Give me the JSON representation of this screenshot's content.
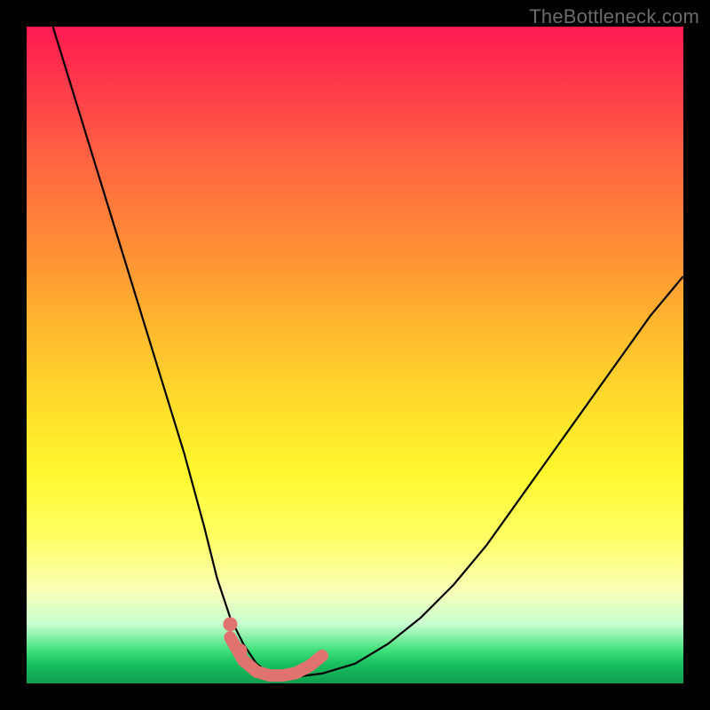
{
  "watermark": {
    "text": "TheBottleneck.com"
  },
  "chart_data": {
    "type": "line",
    "title": "",
    "xlabel": "",
    "ylabel": "",
    "xlim": [
      0,
      100
    ],
    "ylim": [
      0,
      100
    ],
    "grid": false,
    "gradient_stops": [
      {
        "pos": 0,
        "color": "#ff1a52"
      },
      {
        "pos": 10,
        "color": "#ff3e4a"
      },
      {
        "pos": 22,
        "color": "#ff6a3f"
      },
      {
        "pos": 34,
        "color": "#ff8f35"
      },
      {
        "pos": 46,
        "color": "#ffb92e"
      },
      {
        "pos": 58,
        "color": "#ffde2b"
      },
      {
        "pos": 68,
        "color": "#fff82f"
      },
      {
        "pos": 78,
        "color": "#ffff66"
      },
      {
        "pos": 86,
        "color": "#f8ffb8"
      },
      {
        "pos": 91,
        "color": "#c8ffd0"
      },
      {
        "pos": 95,
        "color": "#3fe07a"
      },
      {
        "pos": 97,
        "color": "#18c060"
      },
      {
        "pos": 100,
        "color": "#0f9e4e"
      }
    ],
    "series": [
      {
        "name": "bottleneck-curve",
        "stroke": "#000000",
        "stroke_width": 2.2,
        "x": [
          4,
          8,
          12,
          16,
          20,
          24,
          27,
          29,
          31,
          33,
          35,
          37,
          39,
          41,
          45,
          50,
          55,
          60,
          65,
          70,
          75,
          80,
          85,
          90,
          95,
          100
        ],
        "y": [
          100,
          87,
          74,
          61,
          48,
          35,
          24,
          16,
          10,
          6,
          3,
          1.5,
          1,
          1,
          1.5,
          3,
          6,
          10,
          15,
          21,
          28,
          35,
          42,
          49,
          56,
          62
        ]
      },
      {
        "name": "valley-marker",
        "stroke": "#e0736e",
        "stroke_width": 14,
        "linecap": "round",
        "x": [
          31,
          33,
          35,
          37,
          39,
          41,
          43,
          45
        ],
        "y": [
          7,
          3.5,
          1.8,
          1.2,
          1.2,
          1.6,
          2.6,
          4.2
        ]
      }
    ],
    "marker_dots": {
      "color": "#e0736e",
      "r": 8,
      "points": [
        {
          "x": 31,
          "y": 9
        },
        {
          "x": 32.5,
          "y": 5
        }
      ]
    }
  }
}
